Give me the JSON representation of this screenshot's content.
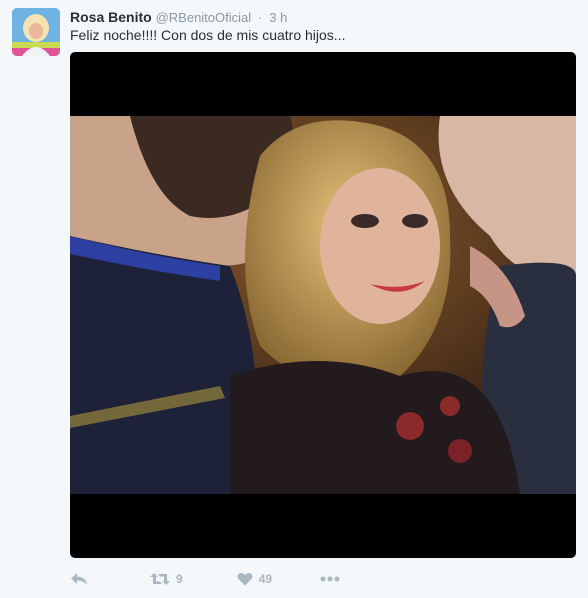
{
  "tweet": {
    "author_name": "Rosa Benito",
    "author_handle": "@RBenitoOficial",
    "separator": "·",
    "time": "3 h",
    "text": "Feliz noche!!!! Con dos de mis cuatro hijos...",
    "avatar_icon": "profile-photo",
    "photo_icon": "photo-three-people-selfie"
  },
  "actions": {
    "reply_icon": "reply-icon",
    "retweet_icon": "retweet-icon",
    "retweet_count": "9",
    "like_icon": "heart-icon",
    "like_count": "49",
    "more_icon": "more-icon"
  },
  "colors": {
    "background": "#f5f8fa",
    "text": "#292f33",
    "muted": "#8899a6",
    "action": "#aab8c2"
  }
}
